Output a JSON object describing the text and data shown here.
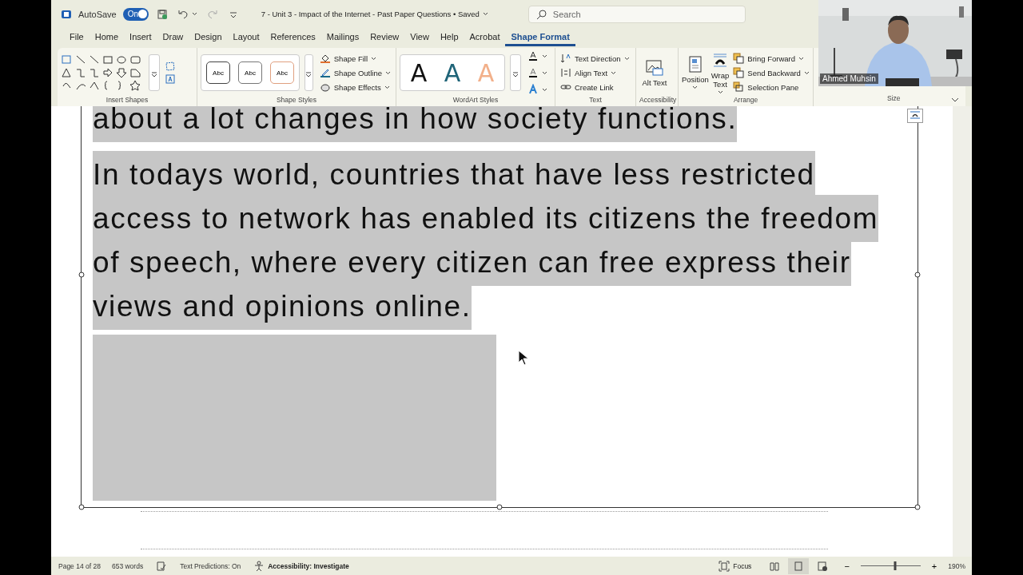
{
  "title_bar": {
    "autosave_label": "AutoSave",
    "autosave": {
      "label": "On",
      "on": true
    },
    "redo_disabled": true,
    "document_title": "7 - Unit 3 - Impact of the Internet - Past Paper Questions • Saved",
    "search": {
      "placeholder": "Search"
    }
  },
  "ribbon_tabs": [
    {
      "label": "File",
      "selected": false
    },
    {
      "label": "Home",
      "selected": false
    },
    {
      "label": "Insert",
      "selected": false
    },
    {
      "label": "Draw",
      "selected": false
    },
    {
      "label": "Design",
      "selected": false
    },
    {
      "label": "Layout",
      "selected": false
    },
    {
      "label": "References",
      "selected": false
    },
    {
      "label": "Mailings",
      "selected": false
    },
    {
      "label": "Review",
      "selected": false
    },
    {
      "label": "View",
      "selected": false
    },
    {
      "label": "Help",
      "selected": false
    },
    {
      "label": "Acrobat",
      "selected": false
    },
    {
      "label": "Shape Format",
      "selected": true
    }
  ],
  "ribbon_groups": [
    {
      "kind": "insert-shapes",
      "label": "Insert Shapes"
    },
    {
      "kind": "shape-styles",
      "label": "Shape Styles",
      "styles": [
        "Abc",
        "Abc",
        "Abc"
      ],
      "commands": [
        "Shape Fill",
        "Shape Outline",
        "Shape Effects"
      ]
    },
    {
      "kind": "wordart",
      "label": "WordArt Styles",
      "styles": [
        "A",
        "A",
        "A"
      ]
    },
    {
      "kind": "text",
      "label": "Text",
      "commands": [
        "Text Direction",
        "Align Text",
        "Create Link"
      ]
    },
    {
      "kind": "accessibility",
      "label": "Accessibility",
      "commands": [
        "Alt Text"
      ]
    },
    {
      "kind": "arrange",
      "label": "Arrange",
      "large": [
        "Position",
        "Wrap Text"
      ],
      "commands": [
        "Bring Forward",
        "Send Backward",
        "Selection Pane"
      ]
    },
    {
      "kind": "size",
      "label": "Size"
    }
  ],
  "document": {
    "paragraphs": [
      {
        "text": "about a lot changes in how society functions.",
        "selected": true
      },
      {
        "text": "In todays world, countries that have less restricted access to network has enabled its citizens the freedom of speech, where every citizen can free express their views and opinions online.",
        "selected": true
      }
    ]
  },
  "webcam": {
    "kind": "picture",
    "name": "Ahmed Muhsin"
  },
  "status_bar": {
    "page": "Page 14 of 28",
    "words": "653 words",
    "text_predictions": "Text Predictions: On",
    "accessibility": "Accessibility: Investigate",
    "focus": "Focus",
    "views": [
      {
        "kind": "read",
        "selected": false
      },
      {
        "kind": "print",
        "selected": true
      },
      {
        "kind": "web",
        "selected": false
      }
    ],
    "zoom_out": "−",
    "zoom": {
      "level": 0.57
    },
    "zoom_in": "+",
    "zoom_percent": "190%"
  }
}
